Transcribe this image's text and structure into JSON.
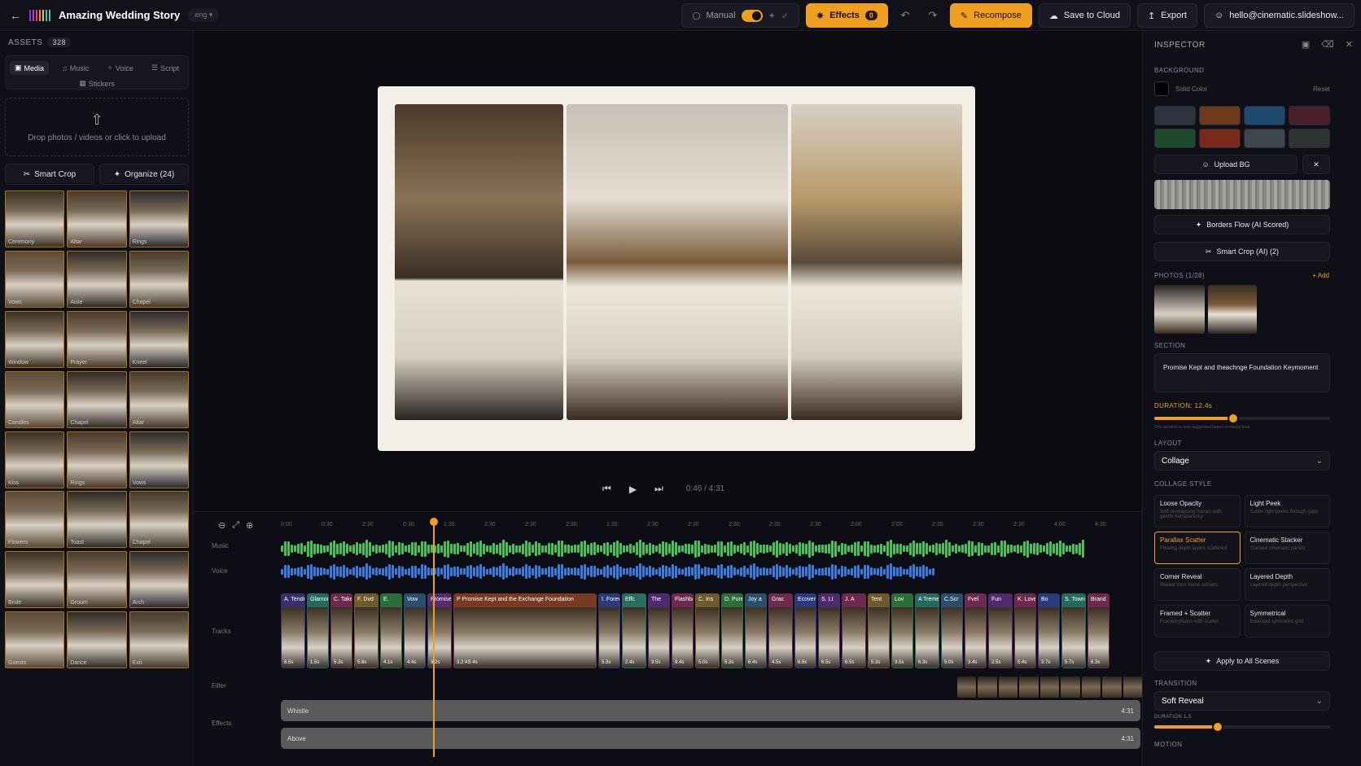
{
  "header": {
    "title": "Amazing Wedding Story",
    "language": "eng",
    "mode_label": "Manual",
    "effects_label": "Effects",
    "effects_count": "0",
    "recompose_label": "Recompose",
    "save_label": "Save to Cloud",
    "export_label": "Export",
    "user_email": "hello@cinematic.slideshow...",
    "logo_colors": [
      "#7b3fe4",
      "#c43fc9",
      "#e63f7a",
      "#f08a2a",
      "#f0c02a",
      "#3fb8e6",
      "#4ad06a"
    ]
  },
  "assets": {
    "title": "ASSETS",
    "count": "328",
    "tabs": [
      "Media",
      "Music",
      "Voice",
      "Script"
    ],
    "tab_stickers": "Stickers",
    "upload_text": "Drop photos / videos or click to upload",
    "smart_crop_label": "Smart Crop",
    "organize_label": "Organize (24)",
    "thumbnails": [
      "Ceremony",
      "Altar",
      "Rings",
      "Vows",
      "Aisle",
      "Chapel",
      "Window",
      "Prayer",
      "Kneel",
      "Candles",
      "Chapel",
      "Altar",
      "Kiss",
      "Rings",
      "Vows",
      "Flowers",
      "Toast",
      "Chapel",
      "Bride",
      "Groom",
      "Arch",
      "Guests",
      "Dance",
      "Exit"
    ]
  },
  "player": {
    "time": "0:46 / 4:31"
  },
  "timeline": {
    "ruler": [
      "0:00",
      "0:30",
      "2:30",
      "0:30",
      "1:30",
      "2:30",
      "2:30",
      "2:30",
      "1:30",
      "2:30",
      "2:30",
      "2:30",
      "2:30",
      "2:30",
      "2:00",
      "2:00",
      "2:30",
      "2:30",
      "2:30",
      "4:00",
      "4:30"
    ],
    "music_label": "Music",
    "voice_label": "Voice",
    "tracks_label": "Tracks",
    "filter_label": "Filter",
    "effects_label": "Effects",
    "bar1_label": "Whistle",
    "bar1_end": "4:31",
    "bar2_label": "Above",
    "bar2_end": "4:31",
    "clips": [
      {
        "t": "A. Tender",
        "d": "8.5s",
        "c": "#3a2f6e"
      },
      {
        "t": "Glamour",
        "d": "1.5s",
        "c": "#236b5e"
      },
      {
        "t": "C. Takeni",
        "d": "5.3s",
        "c": "#6e2a4e"
      },
      {
        "t": "F. Dvd",
        "d": "5.6s",
        "c": "#6e5a2a"
      },
      {
        "t": "E.",
        "d": "4.1s",
        "c": "#2a6e3a"
      },
      {
        "t": "Vow",
        "d": "4.4s",
        "c": "#2a4e6e"
      },
      {
        "t": "Promise",
        "d": "3.2s",
        "c": "#5a2a6e"
      },
      {
        "t": "P Promise Kept and the Exchange Foundation",
        "d": "3.2 AS 4s",
        "c": "#7a3a22"
      },
      {
        "t": "I. Forever",
        "d": "5.3s",
        "c": "#2a3a7a"
      },
      {
        "t": "Effc",
        "d": "2.4s",
        "c": "#2a6e5e"
      },
      {
        "t": "The",
        "d": "3.5s",
        "c": "#4e2a6e"
      },
      {
        "t": "Flashback",
        "d": "9.4s",
        "c": "#6e2a4e"
      },
      {
        "t": "C. Ins",
        "d": "5.0s",
        "c": "#6e5a2a"
      },
      {
        "t": "D. Pure",
        "d": "5.3s",
        "c": "#2a6e3a"
      },
      {
        "t": "Joy a",
        "d": "6.4s",
        "c": "#2a4e6e"
      },
      {
        "t": "Grac",
        "d": "4.5s",
        "c": "#6e2a4e"
      },
      {
        "t": "Ecover",
        "d": "6.8s",
        "c": "#2a3a7a"
      },
      {
        "t": "S. Lt",
        "d": "6.5s",
        "c": "#4e2a6e"
      },
      {
        "t": "J. A",
        "d": "6.5s",
        "c": "#6e2a4e"
      },
      {
        "t": "Tent",
        "d": "5.3s",
        "c": "#6e5a2a"
      },
      {
        "t": "Lov",
        "d": "3.5s",
        "c": "#2a6e3a"
      },
      {
        "t": "A Treme",
        "d": "6.3s",
        "c": "#236b5e"
      },
      {
        "t": "C.Scr",
        "d": "5.0s",
        "c": "#2a4e6e"
      },
      {
        "t": "Fvel",
        "d": "3.4s",
        "c": "#6e2a4e"
      },
      {
        "t": "Fun",
        "d": "2.5s",
        "c": "#4e2a6e"
      },
      {
        "t": "K. Love",
        "d": "5.4s",
        "c": "#6e2a4e"
      },
      {
        "t": "Bo",
        "d": "3.7s",
        "c": "#2a3a7a"
      },
      {
        "t": "S. Towne",
        "d": "5.7s",
        "c": "#236b5e"
      },
      {
        "t": "Brand",
        "d": "6.3s",
        "c": "#6e2a4e"
      }
    ]
  },
  "inspector": {
    "title": "INSPECTOR",
    "background_label": "BACKGROUND",
    "solid_color": "Solid Color",
    "reset": "Reset",
    "swatches": [
      "#2d3440",
      "#6e3a1a",
      "#1e4a6e",
      "#4a1e2a",
      "#1e4a2e",
      "#7a2a1a",
      "#3e4650",
      "#2e3232"
    ],
    "upload_bg": "Upload BG",
    "borders_flow": "Borders Flow (AI Scored)",
    "smart_crop": "Smart Crop (AI) (2)",
    "photos_label": "PHOTOS (1/28)",
    "add": "+ Add",
    "section_label": "SECTION",
    "section_text": "Promise Kept and theachnge Foundation Keymoment",
    "duration_label": "DURATION: 12.4s",
    "duration_fraction": 0.45,
    "duration_hint": "This duration is auto-suggested based on music beat",
    "layout_label": "LAYOUT",
    "layout_value": "Collage",
    "collage_label": "COLLAGE STYLE",
    "styles": [
      {
        "n": "Loose Opacity",
        "d": "Soft overlapping frames with gentle transparency"
      },
      {
        "n": "Light Peek",
        "d": "Subtle light peeks through gaps"
      },
      {
        "n": "Parallax Scatter",
        "d": "Floating depth layers scattered"
      },
      {
        "n": "Cinematic Stacker",
        "d": "Stacked cinematic panels"
      },
      {
        "n": "Corner Reveal",
        "d": "Reveal from frame corners"
      },
      {
        "n": "Layered Depth",
        "d": "Layered depth perspective"
      },
      {
        "n": "Framed + Scatter",
        "d": "Framed photos with scatter"
      },
      {
        "n": "Symmetrical",
        "d": "Balanced symmetric grid"
      }
    ],
    "selected_style": 2,
    "apply_all": "Apply to All Scenes",
    "transition_label": "TRANSITION",
    "transition_value": "Soft Reveal",
    "trans_duration_label": "DURATION 1.5",
    "trans_fraction": 0.36,
    "motion_label": "MOTION"
  }
}
